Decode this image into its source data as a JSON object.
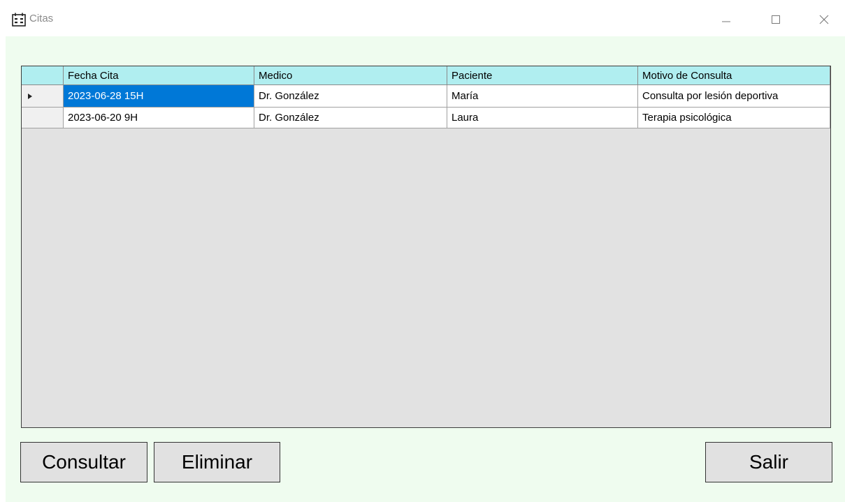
{
  "window": {
    "title": "Citas",
    "icon": "calendar-icon",
    "controls": [
      "minimize-icon",
      "maximize-icon",
      "close-icon"
    ]
  },
  "grid": {
    "columns": [
      "Fecha Cita",
      "Medico",
      "Paciente",
      "Motivo de Consulta"
    ],
    "rows": [
      {
        "fecha": "2023-06-28 15H",
        "medico": "Dr. González",
        "paciente": "María",
        "motivo": "Consulta por lesión deportiva",
        "current": true
      },
      {
        "fecha": "2023-06-20 9H",
        "medico": "Dr. González",
        "paciente": "Laura",
        "motivo": "Terapia psicológica",
        "current": false
      }
    ]
  },
  "buttons": {
    "consultar": "Consultar",
    "eliminar": "Eliminar",
    "salir": "Salir"
  },
  "colors": {
    "client_bg": "#effcef",
    "header_bg": "#b0eef0",
    "selection": "#0078d7",
    "grid_bg": "#e2e2e2"
  }
}
